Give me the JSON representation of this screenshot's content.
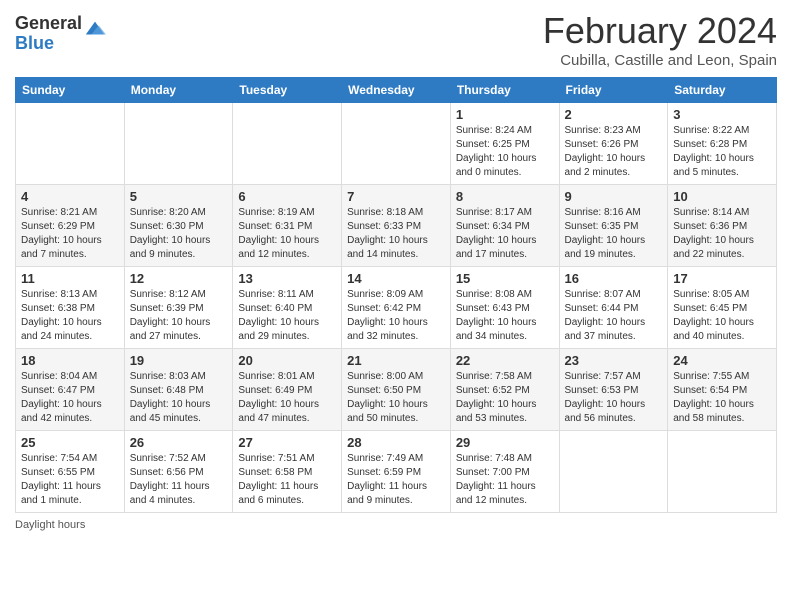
{
  "logo": {
    "general": "General",
    "blue": "Blue"
  },
  "header": {
    "month": "February 2024",
    "location": "Cubilla, Castille and Leon, Spain"
  },
  "weekdays": [
    "Sunday",
    "Monday",
    "Tuesday",
    "Wednesday",
    "Thursday",
    "Friday",
    "Saturday"
  ],
  "weeks": [
    [
      {
        "day": "",
        "info": ""
      },
      {
        "day": "",
        "info": ""
      },
      {
        "day": "",
        "info": ""
      },
      {
        "day": "",
        "info": ""
      },
      {
        "day": "1",
        "info": "Sunrise: 8:24 AM\nSunset: 6:25 PM\nDaylight: 10 hours and 0 minutes."
      },
      {
        "day": "2",
        "info": "Sunrise: 8:23 AM\nSunset: 6:26 PM\nDaylight: 10 hours and 2 minutes."
      },
      {
        "day": "3",
        "info": "Sunrise: 8:22 AM\nSunset: 6:28 PM\nDaylight: 10 hours and 5 minutes."
      }
    ],
    [
      {
        "day": "4",
        "info": "Sunrise: 8:21 AM\nSunset: 6:29 PM\nDaylight: 10 hours and 7 minutes."
      },
      {
        "day": "5",
        "info": "Sunrise: 8:20 AM\nSunset: 6:30 PM\nDaylight: 10 hours and 9 minutes."
      },
      {
        "day": "6",
        "info": "Sunrise: 8:19 AM\nSunset: 6:31 PM\nDaylight: 10 hours and 12 minutes."
      },
      {
        "day": "7",
        "info": "Sunrise: 8:18 AM\nSunset: 6:33 PM\nDaylight: 10 hours and 14 minutes."
      },
      {
        "day": "8",
        "info": "Sunrise: 8:17 AM\nSunset: 6:34 PM\nDaylight: 10 hours and 17 minutes."
      },
      {
        "day": "9",
        "info": "Sunrise: 8:16 AM\nSunset: 6:35 PM\nDaylight: 10 hours and 19 minutes."
      },
      {
        "day": "10",
        "info": "Sunrise: 8:14 AM\nSunset: 6:36 PM\nDaylight: 10 hours and 22 minutes."
      }
    ],
    [
      {
        "day": "11",
        "info": "Sunrise: 8:13 AM\nSunset: 6:38 PM\nDaylight: 10 hours and 24 minutes."
      },
      {
        "day": "12",
        "info": "Sunrise: 8:12 AM\nSunset: 6:39 PM\nDaylight: 10 hours and 27 minutes."
      },
      {
        "day": "13",
        "info": "Sunrise: 8:11 AM\nSunset: 6:40 PM\nDaylight: 10 hours and 29 minutes."
      },
      {
        "day": "14",
        "info": "Sunrise: 8:09 AM\nSunset: 6:42 PM\nDaylight: 10 hours and 32 minutes."
      },
      {
        "day": "15",
        "info": "Sunrise: 8:08 AM\nSunset: 6:43 PM\nDaylight: 10 hours and 34 minutes."
      },
      {
        "day": "16",
        "info": "Sunrise: 8:07 AM\nSunset: 6:44 PM\nDaylight: 10 hours and 37 minutes."
      },
      {
        "day": "17",
        "info": "Sunrise: 8:05 AM\nSunset: 6:45 PM\nDaylight: 10 hours and 40 minutes."
      }
    ],
    [
      {
        "day": "18",
        "info": "Sunrise: 8:04 AM\nSunset: 6:47 PM\nDaylight: 10 hours and 42 minutes."
      },
      {
        "day": "19",
        "info": "Sunrise: 8:03 AM\nSunset: 6:48 PM\nDaylight: 10 hours and 45 minutes."
      },
      {
        "day": "20",
        "info": "Sunrise: 8:01 AM\nSunset: 6:49 PM\nDaylight: 10 hours and 47 minutes."
      },
      {
        "day": "21",
        "info": "Sunrise: 8:00 AM\nSunset: 6:50 PM\nDaylight: 10 hours and 50 minutes."
      },
      {
        "day": "22",
        "info": "Sunrise: 7:58 AM\nSunset: 6:52 PM\nDaylight: 10 hours and 53 minutes."
      },
      {
        "day": "23",
        "info": "Sunrise: 7:57 AM\nSunset: 6:53 PM\nDaylight: 10 hours and 56 minutes."
      },
      {
        "day": "24",
        "info": "Sunrise: 7:55 AM\nSunset: 6:54 PM\nDaylight: 10 hours and 58 minutes."
      }
    ],
    [
      {
        "day": "25",
        "info": "Sunrise: 7:54 AM\nSunset: 6:55 PM\nDaylight: 11 hours and 1 minute."
      },
      {
        "day": "26",
        "info": "Sunrise: 7:52 AM\nSunset: 6:56 PM\nDaylight: 11 hours and 4 minutes."
      },
      {
        "day": "27",
        "info": "Sunrise: 7:51 AM\nSunset: 6:58 PM\nDaylight: 11 hours and 6 minutes."
      },
      {
        "day": "28",
        "info": "Sunrise: 7:49 AM\nSunset: 6:59 PM\nDaylight: 11 hours and 9 minutes."
      },
      {
        "day": "29",
        "info": "Sunrise: 7:48 AM\nSunset: 7:00 PM\nDaylight: 11 hours and 12 minutes."
      },
      {
        "day": "",
        "info": ""
      },
      {
        "day": "",
        "info": ""
      }
    ]
  ],
  "footer": {
    "daylight_label": "Daylight hours"
  }
}
